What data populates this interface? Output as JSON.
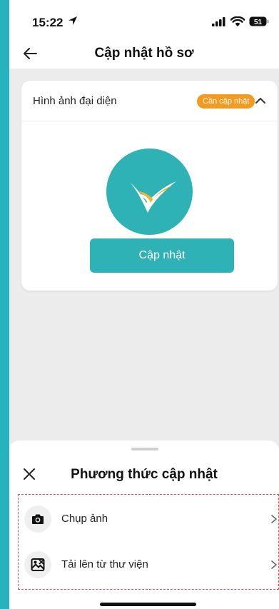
{
  "status_bar": {
    "time": "15:22",
    "battery": "51"
  },
  "header": {
    "title": "Cập nhật hồ sơ"
  },
  "avatar_card": {
    "title": "Hình ảnh đại diện",
    "badge": "Cần cập nhật",
    "button_label": "Cập nhật"
  },
  "sheet": {
    "title": "Phương thức cập nhật",
    "options": [
      {
        "label": "Chụp ảnh",
        "icon": "camera-icon"
      },
      {
        "label": "Tải lên từ thư viện",
        "icon": "gallery-icon"
      }
    ]
  },
  "colors": {
    "accent": "#2eb2b5",
    "badge": "#f39a1f",
    "outer_background": "#27b3bd",
    "highlight_border": "#e24d4d"
  }
}
